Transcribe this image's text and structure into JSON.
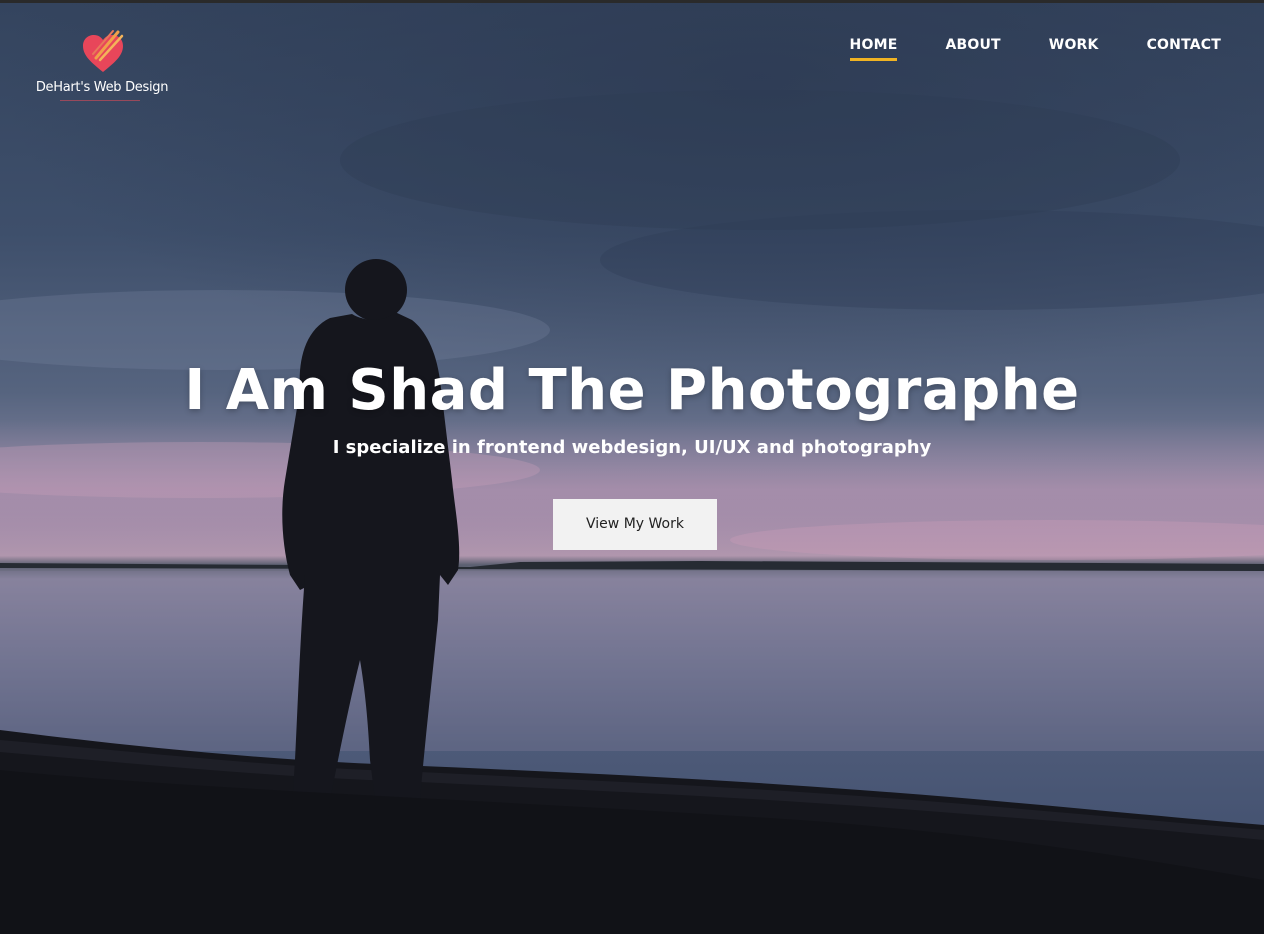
{
  "brand": {
    "logo_text": "DeHart's Web Design",
    "logo_icon": "heart-brush-icon",
    "accent_color": "#f0b323",
    "logo_color": "#e8465a"
  },
  "nav": {
    "items": [
      {
        "label": "HOME",
        "active": true
      },
      {
        "label": "ABOUT",
        "active": false
      },
      {
        "label": "WORK",
        "active": false
      },
      {
        "label": "CONTACT",
        "active": false
      }
    ]
  },
  "hero": {
    "title": "I Am Shad The Photographe",
    "subtitle": "I specialize in frontend webdesign, UI/UX and photography",
    "cta_label": "View My Work"
  }
}
